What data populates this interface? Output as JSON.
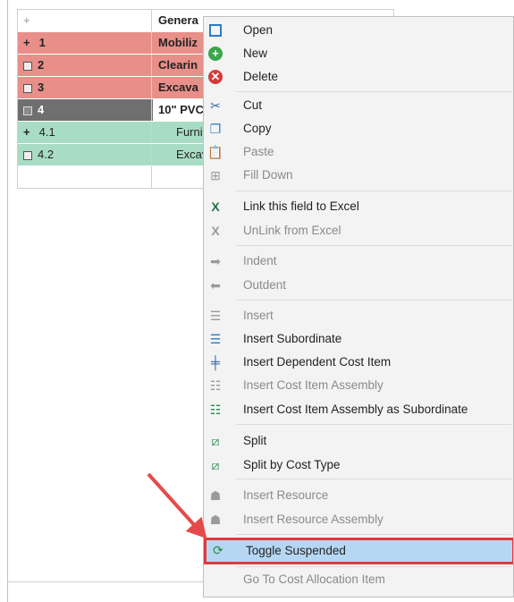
{
  "grid": {
    "header": {
      "c1": "+",
      "c2": "Genera"
    },
    "rows": [
      {
        "id": "1",
        "desc": "Mobiliz",
        "style": "red",
        "expander": "+"
      },
      {
        "id": "2",
        "desc": "Clearin",
        "style": "red",
        "expander": "square"
      },
      {
        "id": "3",
        "desc": "Excava",
        "style": "red",
        "expander": "square"
      },
      {
        "id": "4",
        "desc": "10\" PVC",
        "style": "dark",
        "expander": "minus"
      },
      {
        "id": "4.1",
        "desc": "Furnis",
        "style": "green",
        "expander": "+"
      },
      {
        "id": "4.2",
        "desc": "Excav",
        "style": "green",
        "expander": "square"
      }
    ]
  },
  "menu": {
    "items": [
      {
        "label": "Open",
        "icon": "open-icon",
        "disabled": false
      },
      {
        "label": "New",
        "icon": "new-icon",
        "disabled": false
      },
      {
        "label": "Delete",
        "icon": "delete-icon",
        "disabled": false
      },
      {
        "label": "Cut",
        "icon": "scissors-icon",
        "disabled": false
      },
      {
        "label": "Copy",
        "icon": "copy-icon",
        "disabled": false
      },
      {
        "label": "Paste",
        "icon": "paste-icon",
        "disabled": true
      },
      {
        "label": "Fill Down",
        "icon": "fill-down-icon",
        "disabled": true
      },
      {
        "label": "Link this field to Excel",
        "icon": "excel-link-icon",
        "disabled": false
      },
      {
        "label": "UnLink from Excel",
        "icon": "excel-unlink-icon",
        "disabled": true
      },
      {
        "label": "Indent",
        "icon": "indent-icon",
        "disabled": true
      },
      {
        "label": "Outdent",
        "icon": "outdent-icon",
        "disabled": true
      },
      {
        "label": "Insert",
        "icon": "insert-icon",
        "disabled": true
      },
      {
        "label": "Insert Subordinate",
        "icon": "insert-subordinate-icon",
        "disabled": false
      },
      {
        "label": "Insert Dependent Cost Item",
        "icon": "insert-dependent-icon",
        "disabled": false
      },
      {
        "label": "Insert Cost Item Assembly",
        "icon": "insert-assembly-icon",
        "disabled": true
      },
      {
        "label": "Insert Cost Item Assembly as Subordinate",
        "icon": "insert-assembly-subordinate-icon",
        "disabled": false
      },
      {
        "label": "Split",
        "icon": "split-icon",
        "disabled": false
      },
      {
        "label": "Split by Cost Type",
        "icon": "split-cost-type-icon",
        "disabled": false
      },
      {
        "label": "Insert Resource",
        "icon": "insert-resource-icon",
        "disabled": true
      },
      {
        "label": "Insert Resource Assembly",
        "icon": "insert-resource-assembly-icon",
        "disabled": true
      },
      {
        "label": "Toggle Suspended",
        "icon": "toggle-suspended-icon",
        "disabled": false,
        "highlighted": true
      },
      {
        "label": "Go To Cost Allocation Item",
        "icon": "",
        "disabled": true
      }
    ]
  },
  "colors": {
    "red_row": "#e88f8a",
    "dark_row": "#6f6f6f",
    "green_row": "#a9dcc4",
    "highlight": "#b6d7f3",
    "annotation": "#e03a3a"
  }
}
